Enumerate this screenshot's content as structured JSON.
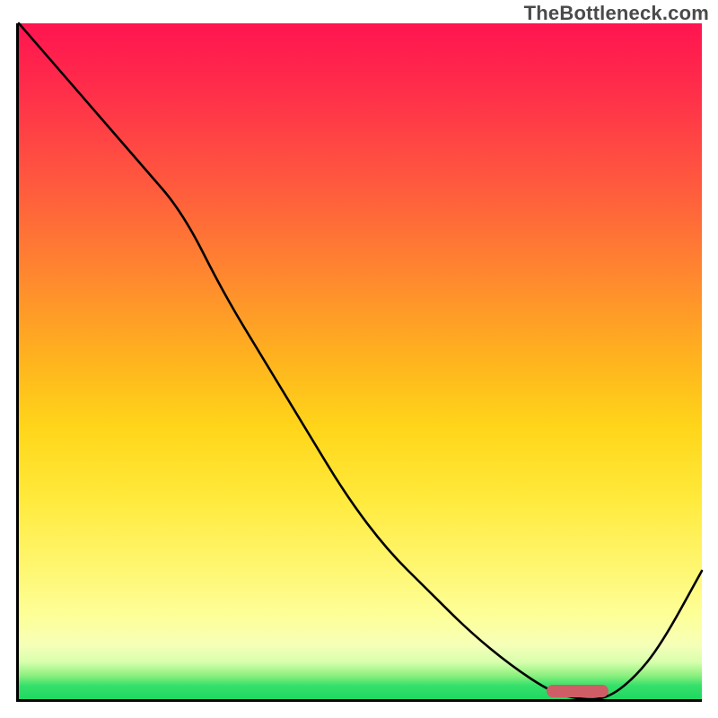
{
  "watermark": "TheBottleneck.com",
  "colors": {
    "border": "#000000",
    "curve": "#000000",
    "marker": "#cf5d66"
  },
  "chart_data": {
    "type": "line",
    "title": "",
    "xlabel": "",
    "ylabel": "",
    "xlim": [
      0,
      100
    ],
    "ylim": [
      0,
      100
    ],
    "grid": false,
    "series": [
      {
        "name": "curve",
        "x": [
          0,
          6,
          12,
          18,
          24,
          30,
          36,
          42,
          48,
          54,
          60,
          66,
          72,
          78,
          82,
          86,
          90,
          94,
          100
        ],
        "y": [
          100,
          93,
          86,
          79,
          72,
          60,
          50,
          40,
          30,
          22,
          16,
          10,
          5,
          1,
          0,
          0,
          3,
          8,
          19
        ]
      }
    ],
    "annotations": [
      {
        "kind": "marker-bar",
        "x_start": 77,
        "x_end": 86,
        "y": 0
      }
    ],
    "background": "red-yellow-green vertical gradient"
  }
}
